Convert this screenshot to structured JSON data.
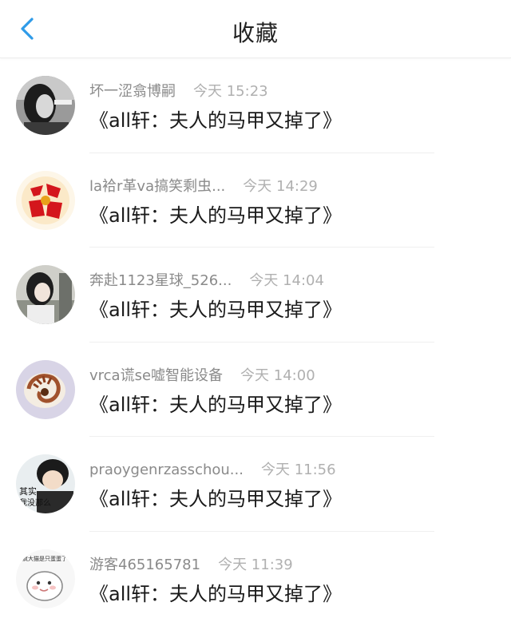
{
  "header": {
    "title": "收藏",
    "back_icon": "chevron-left-icon",
    "accent_color": "#2f9be8"
  },
  "items": [
    {
      "username": "坏一涩翕博嗣",
      "time": "今天 15:23",
      "title": "《all轩：夫人的马甲又掉了》",
      "avatar": "avatar-grayscale-woman"
    },
    {
      "username": "la袷r革va搞笑剩虫...",
      "time": "今天 14:29",
      "title": "《all轩：夫人的马甲又掉了》",
      "avatar": "avatar-red-fu-character"
    },
    {
      "username": "奔赴1123星球_526...",
      "time": "今天 14:04",
      "title": "《all轩：夫人的马甲又掉了》",
      "avatar": "avatar-girl-photo"
    },
    {
      "username": "vrca谎se嘘智能设备",
      "time": "今天 14:00",
      "title": "《all轩：夫人的马甲又掉了》",
      "avatar": "avatar-nautilus-shell"
    },
    {
      "username": "praoygenrzasschou...",
      "time": "今天 11:56",
      "title": "《all轩：夫人的马甲又掉了》",
      "avatar": "avatar-boy-meme"
    },
    {
      "username": "游客465165781",
      "time": "今天 11:39",
      "title": "《all轩：夫人的马甲又掉了》",
      "avatar": "avatar-hamster-meme"
    }
  ],
  "avatar_texts": {
    "boy_meme": "其实 我没那么",
    "hamster_meme": "疯大猫是只蛋蛋了"
  }
}
